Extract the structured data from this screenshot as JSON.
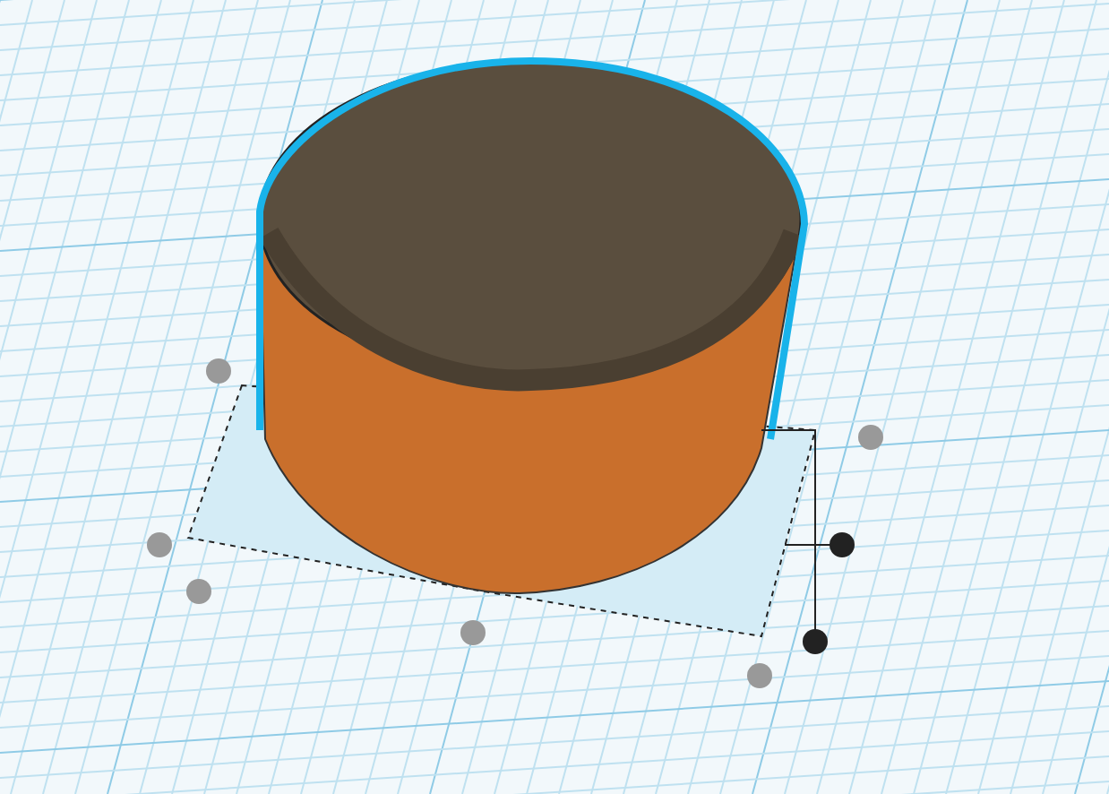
{
  "workplane": {
    "shape": {
      "kind": "cylinder",
      "selected": true
    }
  }
}
